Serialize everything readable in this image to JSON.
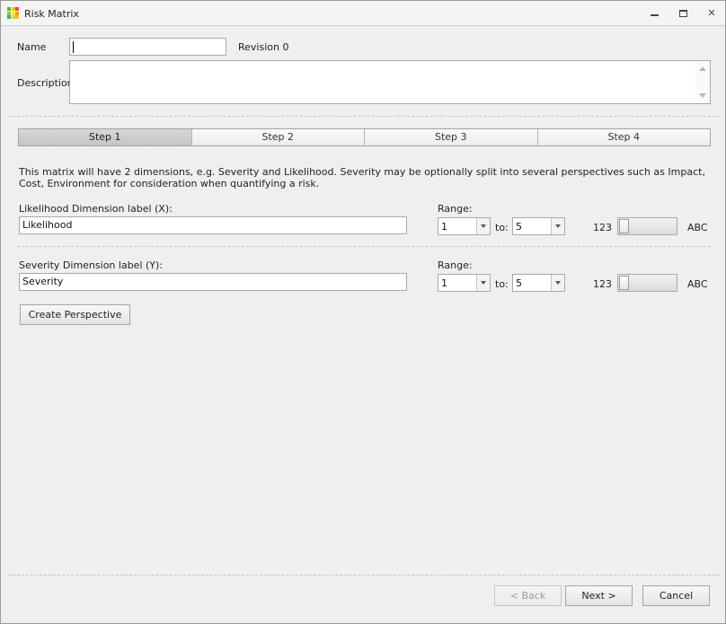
{
  "window": {
    "title": "Risk Matrix",
    "icon_colors": [
      "#4caf50",
      "#ffc107",
      "#f44336",
      "#8bc34a",
      "#ffeb3b",
      "#ff9800",
      "#4caf50",
      "#cddc39",
      "#ffc107"
    ]
  },
  "header": {
    "name_label": "Name",
    "name_value": "",
    "revision": "Revision 0",
    "description_label": "Description",
    "description_value": ""
  },
  "tabs": [
    {
      "label": "Step 1",
      "active": true
    },
    {
      "label": "Step 2",
      "active": false
    },
    {
      "label": "Step 3",
      "active": false
    },
    {
      "label": "Step 4",
      "active": false
    }
  ],
  "info_text": "This matrix will have 2 dimensions, e.g. Severity and Likelihood. Severity may be optionally split into several perspectives such as Impact, Cost, Environment for consideration when quantifying a risk.",
  "dimensions": {
    "x": {
      "label": "Likelihood Dimension label (X):",
      "value": "Likelihood",
      "range_label": "Range:",
      "range_from": "1",
      "to_label": "to:",
      "range_to": "5",
      "toggle_left": "123",
      "toggle_right": "ABC"
    },
    "y": {
      "label": "Severity Dimension label (Y):",
      "value": "Severity",
      "range_label": "Range:",
      "range_from": "1",
      "to_label": "to:",
      "range_to": "5",
      "toggle_left": "123",
      "toggle_right": "ABC"
    }
  },
  "create_perspective_label": "Create Perspective",
  "footer": {
    "back_label": "< Back",
    "next_label": "Next >",
    "cancel_label": "Cancel"
  }
}
